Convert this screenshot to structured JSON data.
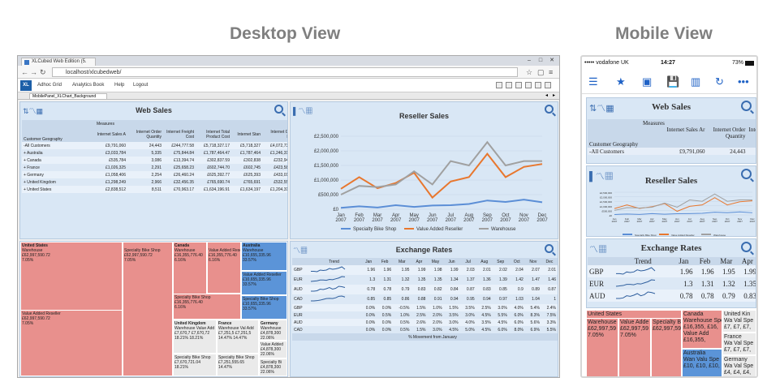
{
  "headings": {
    "desktop": "Desktop View",
    "mobile": "Mobile View"
  },
  "browser": {
    "tab_title": "XLCubed Web Edition (5.",
    "url": "localhost/xlcubedweb/",
    "logo": "XL",
    "menu": [
      "Adhoc Grid",
      "Analytics Book",
      "Help",
      "Logout"
    ],
    "sheet_tab": "MobilePanel_XLChart_Background"
  },
  "web_sales": {
    "title": "Web Sales",
    "measures_label": "Measures",
    "row_header": "Customer Geography",
    "columns": [
      "Internet Sales A",
      "Internet Order Quantity",
      "Internet Freight Cost",
      "Internet Total Product Cost",
      "Internet Stan",
      "Internet Gross Profit",
      "Av"
    ],
    "rows": [
      {
        "name": "-All Customers",
        "values": [
          "£9,791,060",
          "24,443",
          "£244,777.58",
          "£5,718,327.17",
          "£5,718,327",
          "£4,072,733.12"
        ]
      },
      {
        "name": "+ Australia",
        "values": [
          "£3,033,784",
          "5,335",
          "£75,844.84",
          "£1,787,464.47",
          "£1,787,464",
          "£1,246,319.74"
        ]
      },
      {
        "name": "+ Canada",
        "values": [
          "£535,784",
          "3,086",
          "£13,394.74",
          "£302,837.59",
          "£302,838",
          "£232,946.88"
        ]
      },
      {
        "name": "+ France",
        "values": [
          "£1,026,325",
          "2,291",
          "£25,658.23",
          "£602,744.70",
          "£602,745",
          "£423,580.27"
        ]
      },
      {
        "name": "+ Germany",
        "values": [
          "£1,058,406",
          "2,254",
          "£26,460.24",
          "£625,392.77",
          "£625,393",
          "£433,012.96"
        ]
      },
      {
        "name": "+ United Kingdom",
        "values": [
          "£1,298,249",
          "2,966",
          "£32,456.35",
          "£765,690.74",
          "£765,691",
          "£532,557.83"
        ]
      },
      {
        "name": "+ United States",
        "values": [
          "£2,838,512",
          "8,511",
          "£70,963.17",
          "£1,634,196.91",
          "£1,634,197",
          "£1,204,315.44"
        ]
      }
    ]
  },
  "reseller_sales": {
    "title": "Reseller Sales",
    "chart_data": {
      "type": "line",
      "categories": [
        "Jan 2007",
        "Feb 2007",
        "Mar 2007",
        "Apr 2007",
        "May 2007",
        "Jun 2007",
        "Jul 2007",
        "Aug 2007",
        "Sep 2007",
        "Oct 2007",
        "Nov 2007",
        "Dec 2007"
      ],
      "ylim": [
        0,
        2500000
      ],
      "y_ticks": [
        "£2,500,000",
        "£2,000,000",
        "£1,500,000",
        "£1,000,000",
        "£500,000",
        "£0"
      ],
      "series": [
        {
          "name": "Specialty Bike Shop",
          "color": "#5b8ed6",
          "values": [
            50000,
            100000,
            60000,
            140000,
            80000,
            130000,
            140000,
            180000,
            300000,
            250000,
            330000,
            240000
          ]
        },
        {
          "name": "Value Added Reseller",
          "color": "#e8772e",
          "values": [
            700000,
            1100000,
            720000,
            900000,
            1250000,
            400000,
            950000,
            1100000,
            1900000,
            1100000,
            1450000,
            1550000
          ]
        },
        {
          "name": "Warehouse",
          "color": "#a0a0a0",
          "values": [
            500000,
            800000,
            760000,
            850000,
            1300000,
            850000,
            1650000,
            1500000,
            2300000,
            1500000,
            1650000,
            1650000
          ]
        }
      ]
    }
  },
  "exchange_rates": {
    "title": "Exchange Rates",
    "columns": [
      "Trend",
      "Jan",
      "Feb",
      "Mar",
      "Apr",
      "May",
      "Jun",
      "Jul",
      "Aug",
      "Sep",
      "Oct",
      "Nov",
      "Dec"
    ],
    "rates": [
      {
        "cur": "GBP",
        "values": [
          "1.96",
          "1.96",
          "1.95",
          "1.99",
          "1.98",
          "1.99",
          "2.03",
          "2.01",
          "2.02",
          "2.04",
          "2.07",
          "2.01"
        ]
      },
      {
        "cur": "EUR",
        "values": [
          "1.3",
          "1.31",
          "1.32",
          "1.35",
          "1.35",
          "1.34",
          "1.37",
          "1.36",
          "1.39",
          "1.42",
          "1.47",
          "1.46"
        ]
      },
      {
        "cur": "AUD",
        "values": [
          "0.78",
          "0.78",
          "0.79",
          "0.83",
          "0.82",
          "0.84",
          "0.87",
          "0.83",
          "0.85",
          "0.9",
          "0.89",
          "0.87"
        ]
      },
      {
        "cur": "CAD",
        "values": [
          "0.85",
          "0.85",
          "0.86",
          "0.88",
          "0.91",
          "0.94",
          "0.95",
          "0.94",
          "0.97",
          "1.03",
          "1.04",
          "1"
        ]
      }
    ],
    "movement": [
      {
        "cur": "GBP",
        "values": [
          "0.0%",
          "0.0%",
          "-0.5%",
          "1.5%",
          "1.0%",
          "1.5%",
          "3.5%",
          "2.5%",
          "3.0%",
          "4.0%",
          "5.4%",
          "2.4%"
        ]
      },
      {
        "cur": "EUR",
        "values": [
          "0.0%",
          "0.5%",
          "1.0%",
          "2.5%",
          "2.0%",
          "3.5%",
          "3.0%",
          "4.5%",
          "5.5%",
          "6.0%",
          "8.3%",
          "7.5%"
        ]
      },
      {
        "cur": "AUD",
        "values": [
          "0.0%",
          "0.0%",
          "0.5%",
          "2.6%",
          "2.0%",
          "3.0%",
          "4.0%",
          "3.5%",
          "4.5%",
          "6.0%",
          "5.6%",
          "3.3%"
        ]
      },
      {
        "cur": "CAD",
        "values": [
          "0.0%",
          "0.0%",
          "0.5%",
          "1.5%",
          "3.0%",
          "4.5%",
          "5.0%",
          "4.5%",
          "6.0%",
          "8.0%",
          "6.9%",
          "5.5%"
        ]
      }
    ],
    "footer": "% Movement from January"
  },
  "treemap": {
    "us": {
      "label": "United States",
      "wh": "Warehouse\n£62,997,590.72\n7.05%",
      "sbs": "Specialty Bike Shop\n£62,997,590.72\n7.05%",
      "var": "Value Added Reseller\n£62,997,590.72\n7.05%"
    },
    "ca": {
      "label": "Canada",
      "wh": "Warehouse\n£16,355,776.40\n6.16%",
      "var": "Value Added Resel\n£16,355,776.40\n6.16%",
      "sbs": "Specialty Bike Shop\n£16,355,776.40\n6.16%"
    },
    "au": {
      "label": "Australia",
      "wh": "Warehouse\n£10,655,335.96\n33.57%",
      "var": "Value Added Reseller\n£10,655,335.96\n33.57%",
      "sbs": "Specialty Bike Shop\n£10,655,335.96\n33.57%"
    },
    "uk": {
      "label": "United Kingdom",
      "wh": "Warehouse Value Add\n£7,670,7 £7,670,72\n18.21% 18.21%",
      "sbs": "Specialty Bike Shop\n£7,670,721.04\n18.21%"
    },
    "fr": {
      "label": "France",
      "wh": "Warehouse Val Add\n£7,251,5 £7,251,5\n14.47% 14.47%",
      "sbs": "Specialty Bike Shop\n£7,251,555.65\n14.47%"
    },
    "de": {
      "label": "Germany",
      "wh": "Warehouse\n£4,878,300\n22.06%",
      "var": "Value Added\n£4,878,300\n22.06%",
      "sbs": "Specialty Bi\n£4,878,300\n22.06%"
    }
  },
  "mobile": {
    "status": {
      "carrier": "••••• vodafone UK",
      "time": "14:27",
      "battery": "73%"
    },
    "web_sales_title": "Web Sales",
    "measures_label": "Measures",
    "row_header": "Customer Geography",
    "columns": [
      "Internet Sales Ar",
      "Internet Order Quantity",
      "Inte"
    ],
    "row": {
      "name": "-All Customers",
      "values": [
        "£9,791,060",
        "24,443"
      ]
    },
    "reseller_title": "Reseller Sales",
    "exchange_title": "Exchange Rates",
    "ex_columns": [
      "Trend",
      "Jan",
      "Feb",
      "Mar",
      "Apr"
    ],
    "ex_rows": [
      {
        "cur": "GBP",
        "values": [
          "1.96",
          "1.96",
          "1.95",
          "1.99"
        ]
      },
      {
        "cur": "EUR",
        "values": [
          "1.3",
          "1.31",
          "1.32",
          "1.35"
        ]
      },
      {
        "cur": "AUD",
        "values": [
          "0.78",
          "0.78",
          "0.79",
          "0.83"
        ]
      }
    ],
    "tm_us": "United States",
    "tm_us_cells": [
      "Warehouse\n£62,997,59\n7.05%",
      "Value Adde\n£62,997,59\n7.05%",
      "Specialty Bi\n£62,997,59"
    ],
    "tm_ca": "Canada",
    "tm_ca_cells": [
      "Warehouse Spe\n£16,355, £16,",
      "Value Add\n£16,355,"
    ],
    "tm_uk": "United Kin",
    "tm_uk_cells": "Wa Val Spe\n£7, £7, £7,",
    "tm_fr": "France",
    "tm_fr_cells": "Wa Val Spe\n£7, £7, £7,",
    "tm_au": "Australia",
    "tm_au_cells": "Wan Valu Spe\n£10, £10, £10,",
    "tm_de": "Germany",
    "tm_de_cells": "Wa Val Spe\n£4, £4, £4,"
  }
}
